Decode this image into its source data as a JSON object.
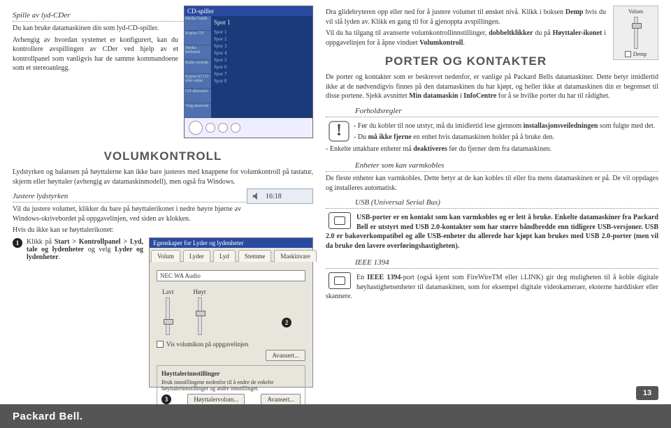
{
  "left": {
    "cd_title": "Spille av lyd-CDer",
    "cd_p1": "Du kan bruke datamaskinen din som lyd-CD-spiller.",
    "cd_p2": "Avhengig av hvordan systemet er konfigurert, kan du kontrollere avspillingen av CDer ved hjelp av et kontrollpanel som vanligvis har de samme kommandoene som et stereoanlegg.",
    "mp": {
      "title": "CD-spiller",
      "now": "Spor 1",
      "side": [
        "Media Guide",
        "Kopier CD",
        "Media-bibliotek",
        "Radio-mottak",
        "Kopier til CD eller enhet",
        "CD-alternativ",
        "Velg utseende"
      ],
      "tracks": [
        "Spor 1",
        "Spor 2",
        "Spor 3",
        "Spor 4",
        "Spor 5",
        "Spor 6",
        "Spor 7",
        "Spor 8"
      ]
    },
    "vol_title": "VOLUMKONTROLL",
    "vol_p1": "Lydstyrken og balansen på høyttalerne kan ikke bare justeres med knappene for volumkontroll på tastatur, skjerm eller høyttaler (avhengig av datamaskinmodell), men også fra Windows.",
    "adj_title": "Justere lydstyrken",
    "adj_p1": "Vil du justere volumet, klikker du bare på høyttalerikonet i nedre høyre hjørne av Windows-skrivebordet på oppgavelinjen, ved siden av klokken.",
    "adj_p2": "Hvis du ikke kan se høyttalerikonet:",
    "clock_time": "16:18",
    "step1_a": "Klikk på ",
    "step1_b": "Start > Kontrollpanel > Lyd, tale og lydenheter",
    "step1_c": " og velg ",
    "step1_d": "Lyder og lydenheter",
    "step1_e": ".",
    "pw": {
      "title": "Egenskaper for Lyder og lydenheter",
      "tabs": [
        "Volum",
        "Lyder",
        "Lyd",
        "Stemme",
        "Maskinvare"
      ],
      "device": "NEC WA Audio",
      "s_low": "Lavt",
      "s_high": "Høyt",
      "chk": "Vis volumikon på oppgavelinjen",
      "adv": "Avansert...",
      "grp": "Høyttalerinnstillinger",
      "grp_txt": "Bruk innstillingene nedenfor til å endre de enkelte høyttalerinnstillinger og andre innstillinger.",
      "btn1": "Høyttalervolum...",
      "btn2": "Avansert..."
    }
  },
  "right": {
    "volum_label": "Volum",
    "demp_label": "Demp",
    "p1_a": "Dra glidebryteren opp eller ned for å justere volumet til ønsket nivå. Klikk i boksen ",
    "p1_b": "Demp",
    "p1_c": " hvis du vil slå lyden av. Klikk en gang til for å gjenoppta avspillingen.",
    "p2_a": "Vil du ha tilgang til avanserte volumkontrollinnstillinger, ",
    "p2_b": "dobbeltklikker",
    "p2_c": " du på ",
    "p2_d": "Høyttaler-ikonet",
    "p2_e": " i oppgavelinjen for å åpne vinduet ",
    "p2_f": "Volumkontroll",
    "p2_g": ".",
    "ports_title": "PORTER OG KONTAKTER",
    "ports_p1_a": "De porter og kontakter som er beskrevet nedenfor, er vanlige på Packard Bells datamaskiner. Dette betyr imidlertid ikke at de nødvendigvis finnes på den datamaskinen du har kjøpt, og heller ikke at datamaskinen din er begrenset til disse portene. Sjekk avsnittet ",
    "ports_p1_b": "Min datamaskin",
    "ports_p1_c": " i ",
    "ports_p1_d": "InfoCentre",
    "ports_p1_e": " for å se hvilke porter du har til rådighet.",
    "rules_title": "Forholdsregler",
    "rules_1a": "- Før du kobler til noe utstyr, må du imidlertid lese gjennom ",
    "rules_1b": "installasjonsveiledningen",
    "rules_1c": " som fulgte med det.",
    "rules_2a": "- Du ",
    "rules_2b": "må ikke fjerne",
    "rules_2c": " en enhet hvis datamaskinen holder på å bruke den.",
    "rules_3a": "- Enkelte uttakbare enheter må ",
    "rules_3b": "deaktiveres",
    "rules_3c": " før du fjerner dem fra datamaskinen.",
    "warm_title": "Enheter som kan varmkobles",
    "warm_p": "De fleste enheter kan varmkobles. Dette betyr at de kan kobles til eller fra mens datamaskinen er på. De vil oppdages og installeres automatisk.",
    "usb_title": "USB (Universal Serial Bus)",
    "usb_a": "USB-porter er en kontakt som kan varmkobles og er lett å bruke. Enkelte datamaskiner fra Packard Bell er utstyrt med USB 2.0-kontakter som har større båndbredde enn tidligere USB-versjoner. USB 2.0",
    "usb_b": " er bakoverkompatibel og alle USB-enheter du allerede har kjøpt kan brukes med USB 2.0-porter (men vil da bruke den lavere overføringshastigheten).",
    "ieee_title": "IEEE 1394",
    "ieee_a": "En ",
    "ieee_b": "IEEE 1394",
    "ieee_c": "-port (også kjent som FireWireTM eller i.LINK) gir deg muligheten til å koble digitale høyhastighetsenheter til datamaskinen, som for eksempel digitale videokameraer, eksterne harddisker eller skannere."
  },
  "footer": {
    "brand": "Packard Bell.",
    "page": "13"
  },
  "nums": {
    "n1": "1",
    "n2": "2",
    "n3": "3"
  }
}
